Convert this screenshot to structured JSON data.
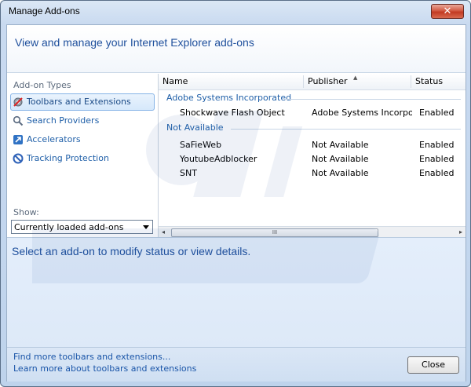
{
  "window": {
    "title": "Manage Add-ons",
    "close_glyph": "✕"
  },
  "header": {
    "title": "View and manage your Internet Explorer add-ons"
  },
  "left": {
    "types_label": "Add-on Types",
    "types": [
      {
        "label": "Toolbars and Extensions",
        "icon": "gear-block-icon",
        "selected": true
      },
      {
        "label": "Search Providers",
        "icon": "search-icon"
      },
      {
        "label": "Accelerators",
        "icon": "accelerator-icon"
      },
      {
        "label": "Tracking Protection",
        "icon": "tracking-protection-icon"
      }
    ],
    "show_label": "Show:",
    "show_value": "Currently loaded add-ons"
  },
  "list": {
    "columns": [
      "Name",
      "Publisher",
      "Status"
    ],
    "groups": [
      {
        "name": "Adobe Systems Incorporated",
        "rows": [
          {
            "name": "Shockwave Flash Object",
            "publisher": "Adobe Systems Incorpor...",
            "status": "Enabled"
          }
        ]
      },
      {
        "name": "Not Available",
        "rows": [
          {
            "name": "SaFieWeb",
            "publisher": "Not Available",
            "status": "Enabled"
          },
          {
            "name": "YoutubeAdblocker",
            "publisher": "Not Available",
            "status": "Enabled"
          },
          {
            "name": "SNT",
            "publisher": "Not Available",
            "status": "Enabled"
          }
        ]
      }
    ],
    "scroll_left": "◂",
    "scroll_right": "▸",
    "scroll_grip": "III"
  },
  "details": {
    "text": "Select an add-on to modify status or view details."
  },
  "footer": {
    "link1": "Find more toolbars and extensions...",
    "link2": "Learn more about toolbars and extensions",
    "close_label": "Close"
  },
  "colors": {
    "accent": "#1e4f9c",
    "link": "#1a55a8"
  }
}
